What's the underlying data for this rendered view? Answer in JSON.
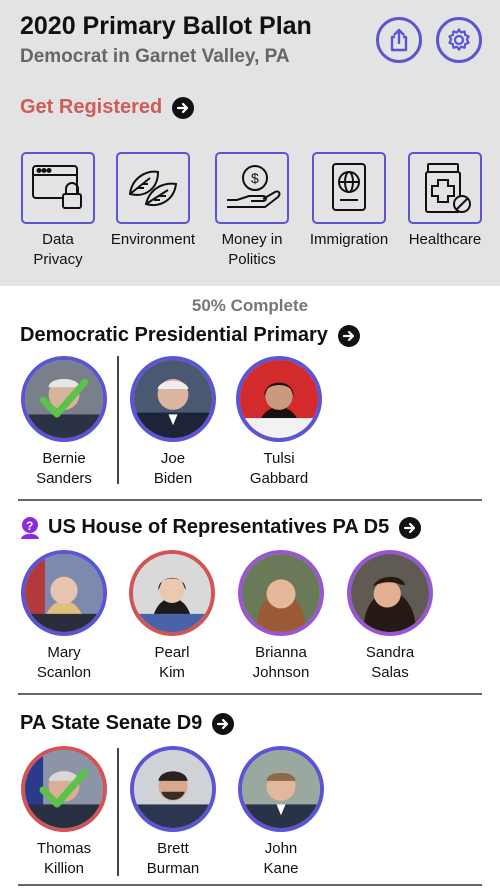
{
  "header": {
    "title": "2020 Primary Ballot Plan",
    "subtitle": "Democrat in Garnet Valley, PA",
    "share_icon": "share-icon",
    "settings_icon": "gear-icon",
    "register_label": "Get Registered"
  },
  "issues": [
    {
      "label_line1": "Data",
      "label_line2": "Privacy",
      "icon": "browser-lock-icon"
    },
    {
      "label_line1": "Environment",
      "label_line2": "",
      "icon": "leaves-icon"
    },
    {
      "label_line1": "Money in",
      "label_line2": "Politics",
      "icon": "money-hand-icon"
    },
    {
      "label_line1": "Immigration",
      "label_line2": "",
      "icon": "passport-icon"
    },
    {
      "label_line1": "Healthcare",
      "label_line2": "",
      "icon": "medicine-icon"
    }
  ],
  "progress": "50% Complete",
  "races": [
    {
      "title": "Democratic Presidential Primary",
      "candidates": [
        {
          "first": "Bernie",
          "last": "Sanders",
          "selected": true
        },
        {
          "first": "Joe",
          "last": "Biden",
          "selected": false
        },
        {
          "first": "Tulsi",
          "last": "Gabbard",
          "selected": false
        }
      ]
    },
    {
      "title": "US House of Representatives PA D5",
      "candidates": [
        {
          "first": "Mary",
          "last": "Scanlon",
          "selected": false
        },
        {
          "first": "Pearl",
          "last": "Kim",
          "selected": false
        },
        {
          "first": "Brianna",
          "last": "Johnson",
          "selected": false
        },
        {
          "first": "Sandra",
          "last": "Salas",
          "selected": false
        }
      ]
    },
    {
      "title": "PA State Senate D9",
      "candidates": [
        {
          "first": "Thomas",
          "last": "Killion",
          "selected": true
        },
        {
          "first": "Brett",
          "last": "Burman",
          "selected": false
        },
        {
          "first": "John",
          "last": "Kane",
          "selected": false
        }
      ]
    }
  ],
  "colors": {
    "accent": "#5b55d6",
    "republican": "#d25555",
    "other_party": "#9a55d6",
    "register": "#cf5b5b",
    "check": "#5cc24a",
    "header_bg": "#e3e3e3"
  }
}
